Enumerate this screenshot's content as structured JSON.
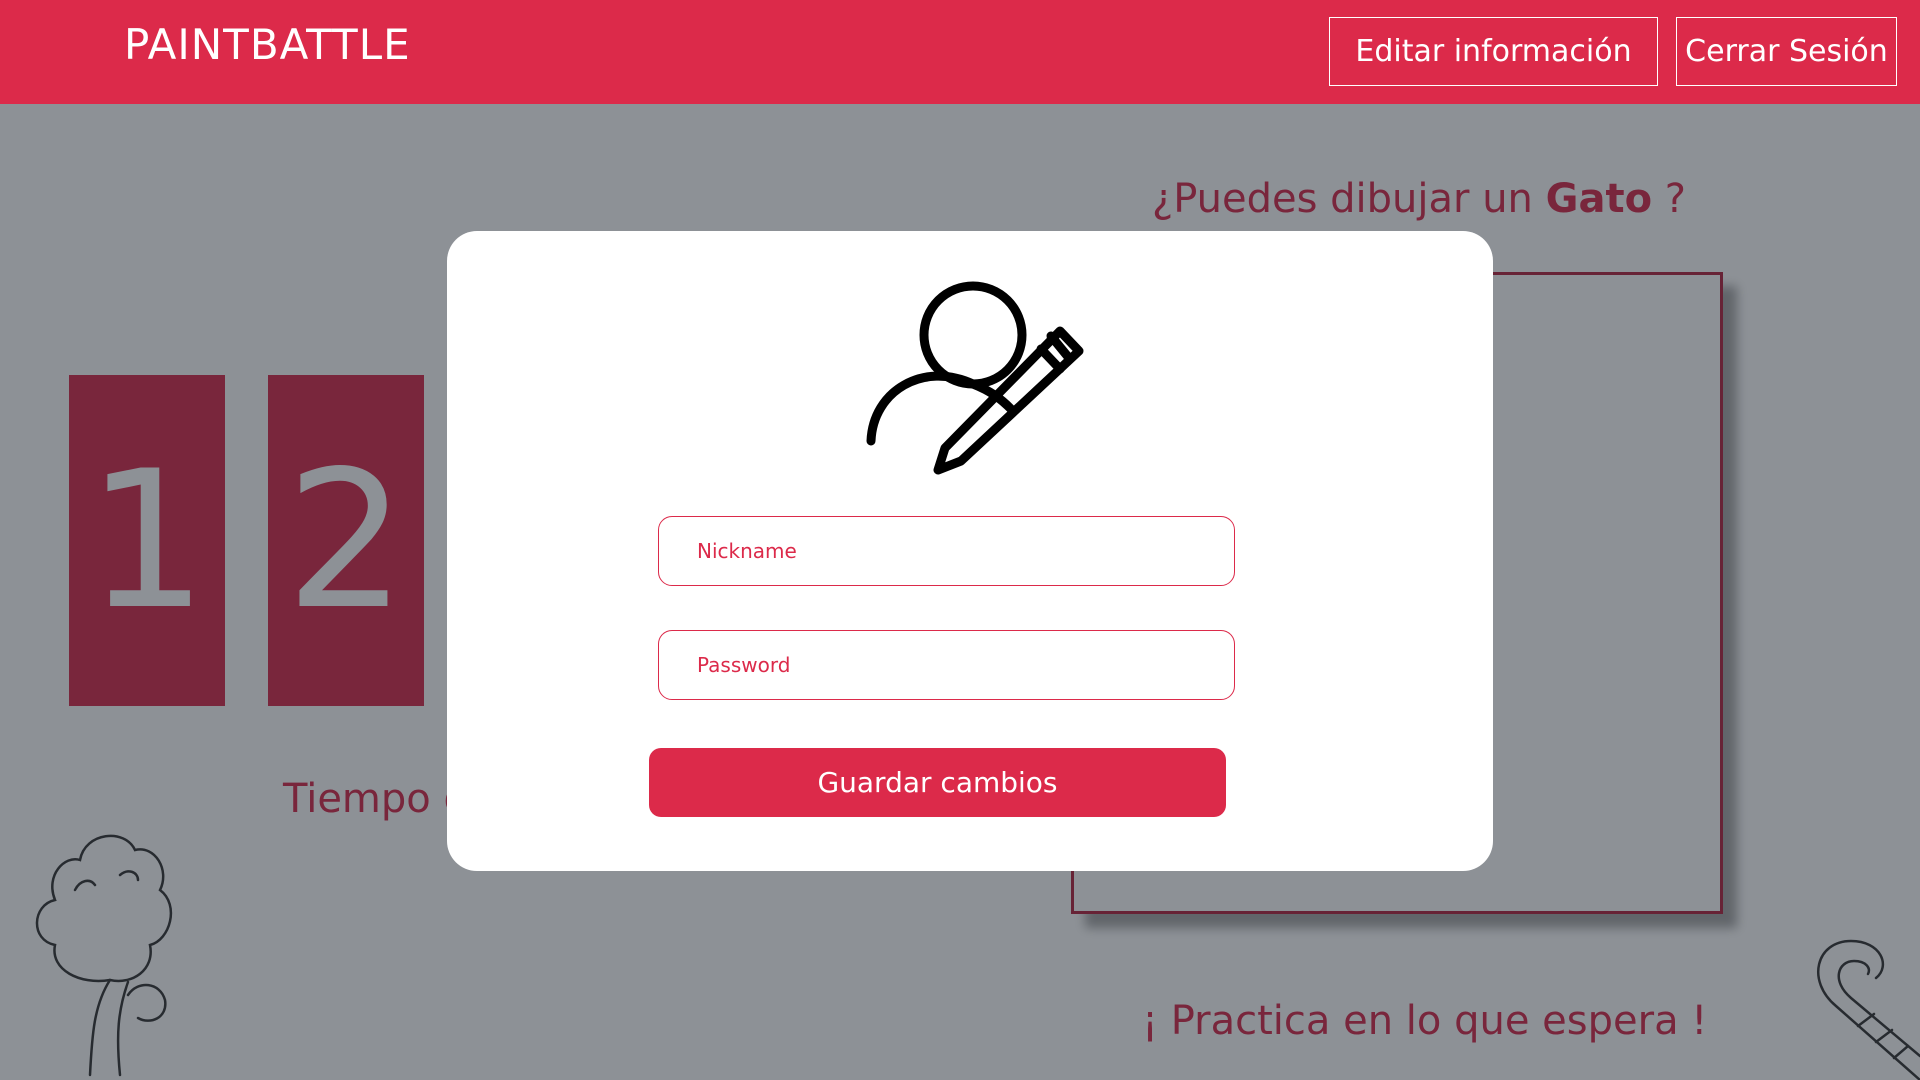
{
  "header": {
    "brand": "PAINTBATTLE",
    "edit_label": "Editar información",
    "logout_label": "Cerrar Sesión"
  },
  "game": {
    "prompt_prefix": "¿Puedes dibujar un ",
    "prompt_word": "Gato",
    "prompt_suffix": " ?",
    "timer_digits": [
      "1",
      "2",
      ":"
    ],
    "time_label": "Tiempo d",
    "practice_text": "¡ Practica en lo que espera !"
  },
  "modal": {
    "icon": "user-edit-icon",
    "nickname_placeholder": "Nickname",
    "password_placeholder": "Password",
    "save_label": "Guardar cambios"
  },
  "colors": {
    "brand": "#dc2a4a",
    "accent_dark": "#b3233f",
    "overlay": "rgba(28,36,45,0.5)"
  }
}
